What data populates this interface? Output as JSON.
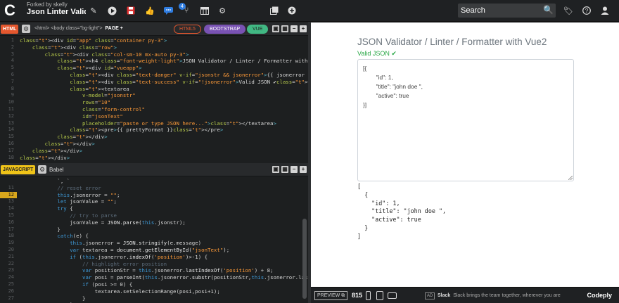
{
  "topbar": {
    "logo": "C",
    "forked_text": "Forked by skelly",
    "project_title": "Json Linter Validat...",
    "search_placeholder": "Search",
    "notification_count": "4"
  },
  "html_panel": {
    "tag": "HTML",
    "breadcrumb_html": "<html>",
    "breadcrumb_body": "<body class=\"bg-light\">",
    "page_plus": "PAGE +",
    "pills": [
      "HTML5",
      "BOOTSTRAP",
      "VUE"
    ],
    "line_numbers": [
      "1",
      "2",
      "3",
      "4",
      "5",
      "6",
      "7",
      "8",
      "9",
      "10",
      "11",
      "12",
      "13",
      "14",
      "15",
      "16",
      "17",
      "18"
    ],
    "lines": [
      "<div id=\"app\" class=\"container py-3\">",
      "    <div class=\"row\">",
      "        <div class=\"col-sm-10 mx-auto py-3\">",
      "            <h4 class=\"font-weight-light\">JSON Validator / Linter / Formatter with Vue2</h4>",
      "            <div id=\"vueapp\">",
      "                <div class=\"text-danger\" v-if=\"jsonstr && jsonerror\">{{ jsonerror }}</div>",
      "                <div class=\"text-success\" v-if=\"!jsonerror\">Valid JSON ✔</div>",
      "                <textarea",
      "                    v-model=\"jsonstr\"",
      "                    rows=\"10\"",
      "                    class=\"form-control\"",
      "                    id=\"jsonText\"",
      "                    placeholder=\"paste or type JSON here...\"></textarea>",
      "                <pre>{{ prettyFormat }}</pre>",
      "            </div>",
      "        </div>",
      "    </div>",
      "</div>"
    ]
  },
  "js_panel": {
    "tag": "JAVASCRIPT",
    "preprocessor": "Babel",
    "line_numbers": [
      "",
      "11",
      "12",
      "13",
      "14",
      "15",
      "16",
      "17",
      "18",
      "19",
      "20",
      "21",
      "22",
      "23",
      "24",
      "25",
      "26",
      "27"
    ],
    "highlight_line": "12",
    "lines": [
      "            `, `",
      "            // reset error",
      "            this.jsonerror = \"\";",
      "            let jsonValue = \"\";",
      "            try {",
      "                // try to parse",
      "                jsonValue = JSON.parse(this.jsonstr);",
      "            }",
      "            catch(e) {",
      "                this.jsonerror = JSON.stringify(e.message)",
      "                var textarea = document.getElementById(\"jsonText\");",
      "                if (this.jsonerror.indexOf('position')>-1) {",
      "                    // highlight error position",
      "                    var positionStr = this.jsonerror.lastIndexOf('position') + 8;",
      "                    var posi = parseInt(this.jsonerror.substr(positionStr,this.jsonerror.lastIn",
      "                    if (posi >= 0) {",
      "                        textarea.setSelectionRange(posi,posi+1);",
      "                    }",
      "                }"
    ]
  },
  "preview": {
    "heading": "JSON Validator / Linter / Formatter with Vue2",
    "valid_text": "Valid JSON ✔",
    "textarea_value": "[{\n        \"id\": 1,\n        \"title\": \"john doe \",\n        \"active\": true\n}]",
    "pretty": "[\n  {\n    \"id\": 1,\n    \"title\": \"john doe \",\n    \"active\": true\n  }\n]"
  },
  "footer": {
    "preview_label": "PREVIEW",
    "count": "815",
    "ad_badge": "AD",
    "ad_brand": "Slack",
    "ad_text": "Slack brings the team together, wherever you are",
    "brand": "Codeply"
  },
  "colors": {
    "html_tag": "#e4572e",
    "js_tag": "#f0c419",
    "html5_pill": "#e4572e",
    "bootstrap_pill": "#7952b3",
    "vue_pill": "#41b883",
    "valid_green": "#28a745",
    "highlight": "#d8a61c"
  }
}
